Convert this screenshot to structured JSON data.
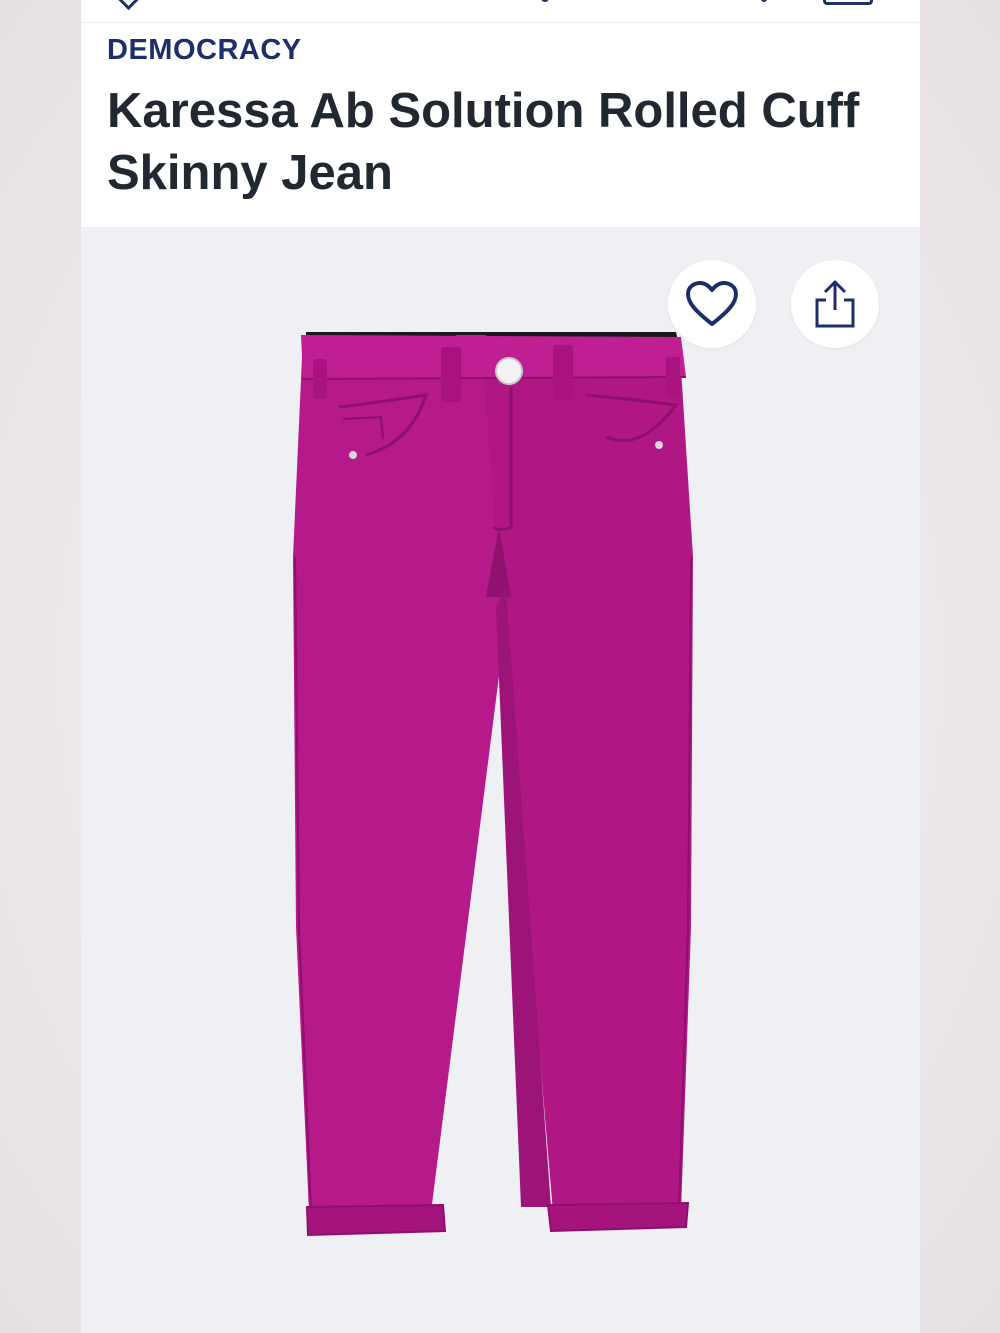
{
  "product": {
    "brand": "DEMOCRACY",
    "title": "Karessa Ab Solution Rolled Cuff Skinny Jean",
    "image_alt": "Karessa Ab Solution Rolled Cuff Skinny Jean"
  },
  "icons": {
    "favorite": "heart-icon",
    "share": "share-icon"
  },
  "colors": {
    "brand_text": "#1c2f6b",
    "title_text": "#222831",
    "image_background": "#eef0f3",
    "product_color": "#b5198a"
  }
}
